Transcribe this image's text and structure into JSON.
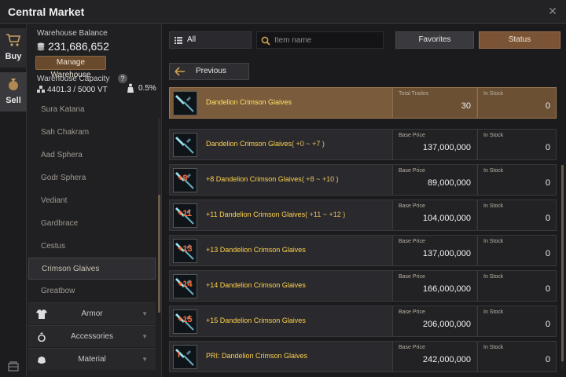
{
  "window": {
    "title": "Central Market",
    "close_icon": "close-icon"
  },
  "leftbar": {
    "buy_label": "Buy",
    "sell_label": "Sell"
  },
  "warehouse": {
    "balance_label": "Warehouse Balance",
    "balance": "231,686,652",
    "manage_label": "Manage Warehouse",
    "capacity_label": "Warehouse Capacity",
    "help": "?",
    "capacity": "4401.3 / 5000 VT",
    "weight_pct": "0.5%"
  },
  "categories": {
    "items": [
      "Sura Katana",
      "Sah Chakram",
      "Aad Sphera",
      "Godr Sphera",
      "Vediant",
      "Gardbrace",
      "Cestus",
      "Crimson Glaives",
      "Greatbow"
    ],
    "selected": "Crimson Glaives",
    "groups": [
      "Armor",
      "Accessories",
      "Material"
    ]
  },
  "toolbar": {
    "all_label": "All",
    "search_placeholder": "Item name",
    "favorites_label": "Favorites",
    "status_label": "Status"
  },
  "nav": {
    "previous_label": "Previous"
  },
  "header_item": {
    "name": "Dandelion Crimson Glaives",
    "col1_label": "Total Trades",
    "col1_value": "30",
    "col2_label": "In Stock",
    "col2_value": "0"
  },
  "listings": [
    {
      "enhance": "",
      "name": "Dandelion Crimson Glaives",
      "range": "( +0 ~ +7 )",
      "price_label": "Base Price",
      "price": "137,000,000",
      "stock_label": "In Stock",
      "stock": "0"
    },
    {
      "enhance": "+8",
      "name": "+8 Dandelion Crimson Glaives",
      "range": "( +8 ~ +10 )",
      "price_label": "Base Price",
      "price": "89,000,000",
      "stock_label": "In Stock",
      "stock": "0"
    },
    {
      "enhance": "+11",
      "name": "+11 Dandelion Crimson Glaives",
      "range": "( +11 ~ +12 )",
      "price_label": "Base Price",
      "price": "104,000,000",
      "stock_label": "In Stock",
      "stock": "0"
    },
    {
      "enhance": "+13",
      "name": "+13 Dandelion Crimson Glaives",
      "range": "",
      "price_label": "Base Price",
      "price": "137,000,000",
      "stock_label": "In Stock",
      "stock": "0"
    },
    {
      "enhance": "+14",
      "name": "+14 Dandelion Crimson Glaives",
      "range": "",
      "price_label": "Base Price",
      "price": "166,000,000",
      "stock_label": "In Stock",
      "stock": "0"
    },
    {
      "enhance": "+15",
      "name": "+15 Dandelion Crimson Glaives",
      "range": "",
      "price_label": "Base Price",
      "price": "206,000,000",
      "stock_label": "In Stock",
      "stock": "0"
    },
    {
      "enhance": "I",
      "name": "PRI: Dandelion Crimson Glaives",
      "range": "",
      "price_label": "Base Price",
      "price": "242,000,000",
      "stock_label": "In Stock",
      "stock": "0"
    }
  ],
  "colors": {
    "accent": "#7a5434",
    "item_name": "#ffd04a",
    "enhance": "#ff6a3a"
  }
}
